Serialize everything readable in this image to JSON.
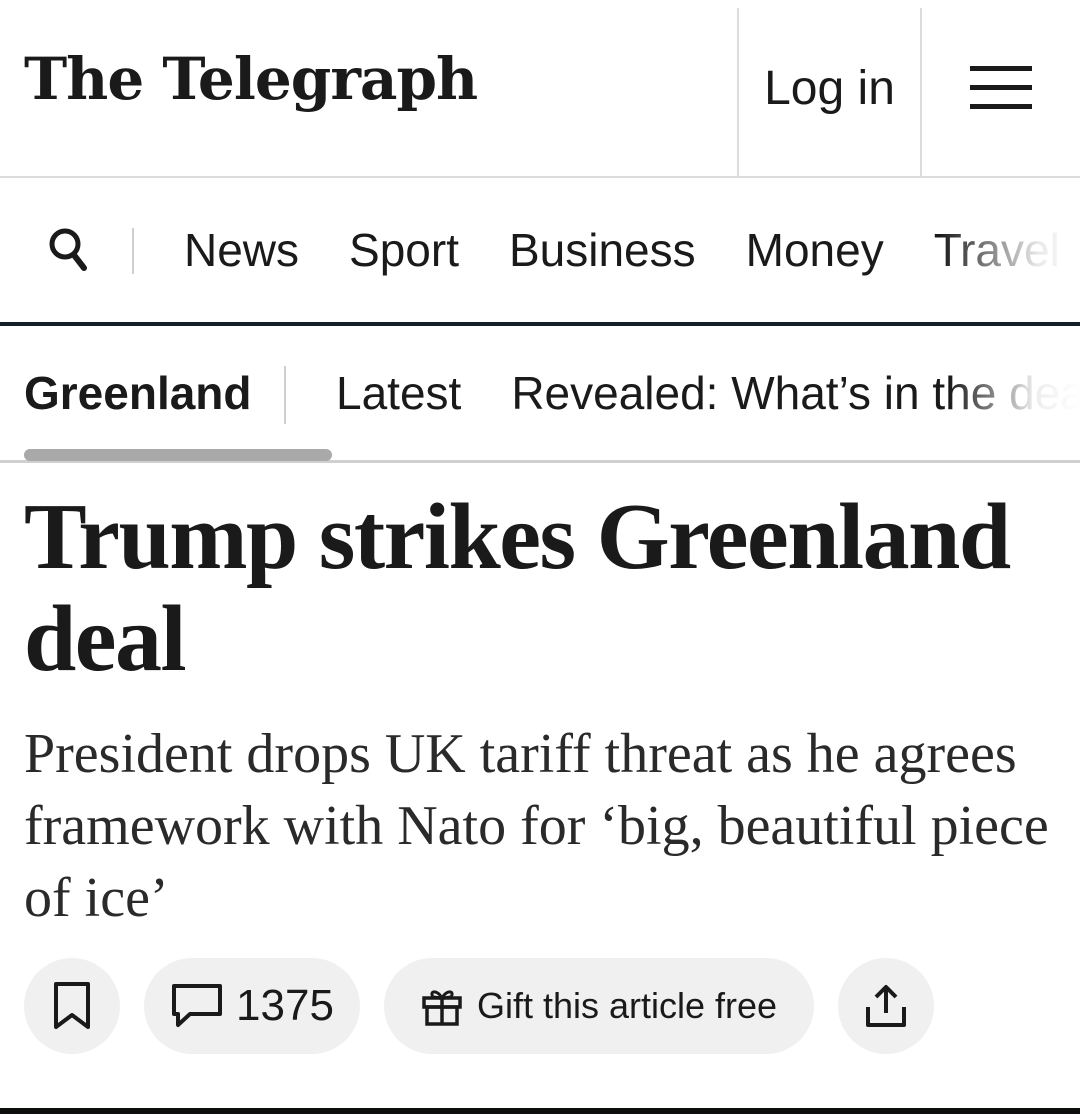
{
  "masthead": {
    "logo_text": "The Telegraph",
    "login_label": "Log in",
    "menu_icon": "hamburger-menu-icon"
  },
  "primary_nav": {
    "search_icon": "search-icon",
    "items": [
      "News",
      "Sport",
      "Business",
      "Money",
      "Travel"
    ]
  },
  "topic_nav": {
    "title": "Greenland",
    "links": [
      "Latest",
      "Revealed: What’s in the deal"
    ]
  },
  "article": {
    "headline": "Trump strikes Greenland deal",
    "standfirst": "President drops UK tariff threat as he agrees framework with Nato for ‘big, beautiful piece of ice’"
  },
  "actions": {
    "comment_count": "1375",
    "gift_label": "Gift this article free"
  },
  "colors": {
    "text": "#1a1a1a",
    "nav_rule": "#14212b",
    "pill_bg": "#f0f0f0",
    "divider": "#dcdcdc"
  }
}
